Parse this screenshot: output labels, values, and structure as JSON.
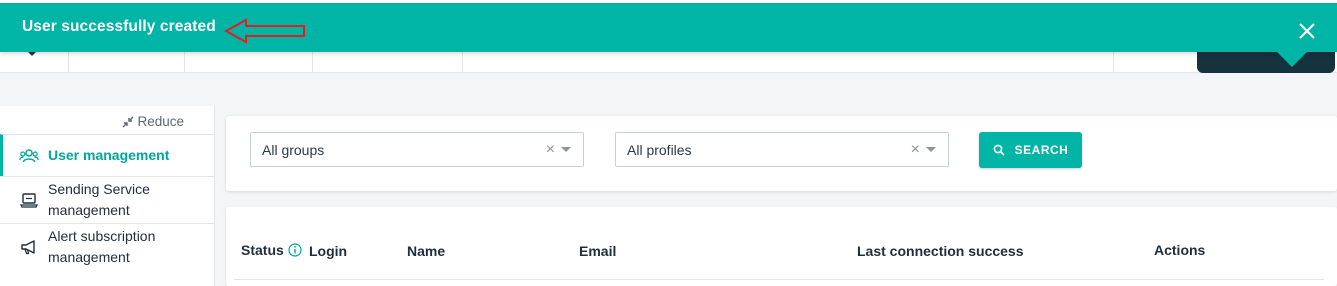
{
  "toast": {
    "message": "User successfully created",
    "close_icon": "close-icon",
    "arrow_icon": "red-arrow-annotation"
  },
  "sidebar": {
    "reduce_label": "Reduce",
    "reduce_icon": "collapse-arrows-icon",
    "items": [
      {
        "label": "User management",
        "icon": "users-icon",
        "active": true
      },
      {
        "label": "Sending Service management",
        "icon": "laptop-icon",
        "active": false
      },
      {
        "label": "Alert subscription management",
        "icon": "megaphone-icon",
        "active": false
      }
    ]
  },
  "filters": {
    "groups": {
      "value": "All groups"
    },
    "profiles": {
      "value": "All profiles"
    },
    "search_label": "SEARCH"
  },
  "table": {
    "columns": [
      "Status",
      "Login",
      "Name",
      "Email",
      "Last connection success",
      "Actions"
    ]
  },
  "colors": {
    "accent": "#00b4a6",
    "dark": "#16323d",
    "annotation": "#e02020"
  }
}
